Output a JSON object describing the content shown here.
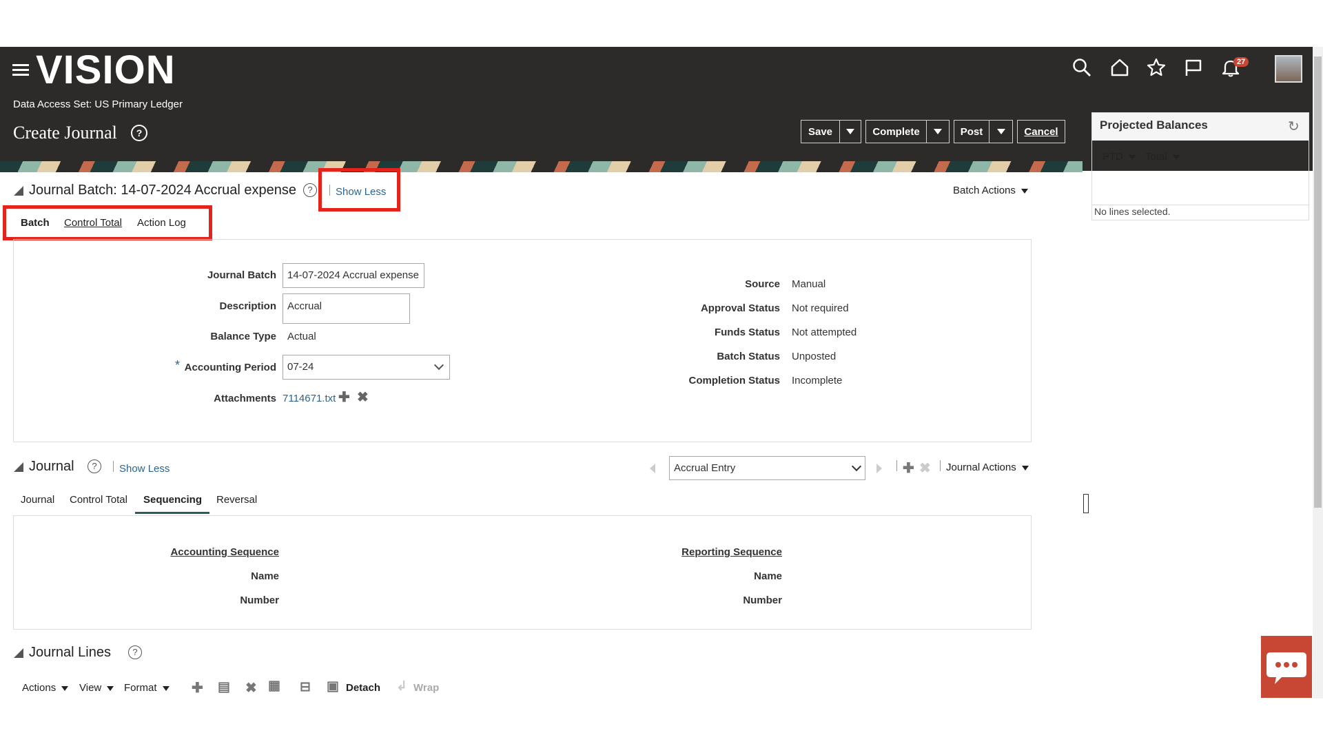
{
  "header": {
    "logo": "VISION",
    "data_access_label": "Data Access Set:",
    "data_access_value": "US Primary Ledger",
    "page_title": "Create Journal",
    "notification_count": "27",
    "buttons": {
      "save": "Save",
      "complete": "Complete",
      "post": "Post",
      "cancel": "Cancel"
    }
  },
  "batch_section": {
    "title": "Journal Batch: 14-07-2024 Accrual expense",
    "show_less": "Show Less",
    "batch_actions": "Batch Actions",
    "tabs": [
      "Batch",
      "Control Total",
      "Action Log"
    ],
    "fields": {
      "journal_batch_label": "Journal Batch",
      "journal_batch_value": "14-07-2024 Accrual expense",
      "description_label": "Description",
      "description_value": "Accrual",
      "balance_type_label": "Balance Type",
      "balance_type_value": "Actual",
      "accounting_period_label": "Accounting Period",
      "accounting_period_value": "07-24",
      "attachments_label": "Attachments",
      "attachments_value": "7114671.txt",
      "required_marker": "*"
    },
    "status": [
      {
        "label": "Source",
        "value": "Manual"
      },
      {
        "label": "Approval Status",
        "value": "Not required"
      },
      {
        "label": "Funds Status",
        "value": "Not attempted"
      },
      {
        "label": "Batch Status",
        "value": "Unposted"
      },
      {
        "label": "Completion Status",
        "value": "Incomplete"
      }
    ]
  },
  "journal_section": {
    "title": "Journal",
    "show_less": "Show Less",
    "journal_select": "Accrual Entry",
    "journal_actions": "Journal Actions",
    "tabs": [
      "Journal",
      "Control Total",
      "Sequencing",
      "Reversal"
    ],
    "active_tab": "Sequencing",
    "accounting_sequence": {
      "heading": "Accounting Sequence",
      "name_label": "Name",
      "number_label": "Number"
    },
    "reporting_sequence": {
      "heading": "Reporting Sequence",
      "name_label": "Name",
      "number_label": "Number"
    }
  },
  "journal_lines": {
    "title": "Journal Lines",
    "toolbar": {
      "actions": "Actions",
      "view": "View",
      "format": "Format",
      "detach": "Detach",
      "wrap": "Wrap"
    }
  },
  "projected_balances": {
    "title": "Projected Balances",
    "ptd": "PTD",
    "total": "Total",
    "empty_message": "No lines selected."
  },
  "colors": {
    "header_bg": "#2c2b29",
    "link": "#2b6490",
    "highlight": "#e4231b",
    "chat": "#c74634"
  }
}
